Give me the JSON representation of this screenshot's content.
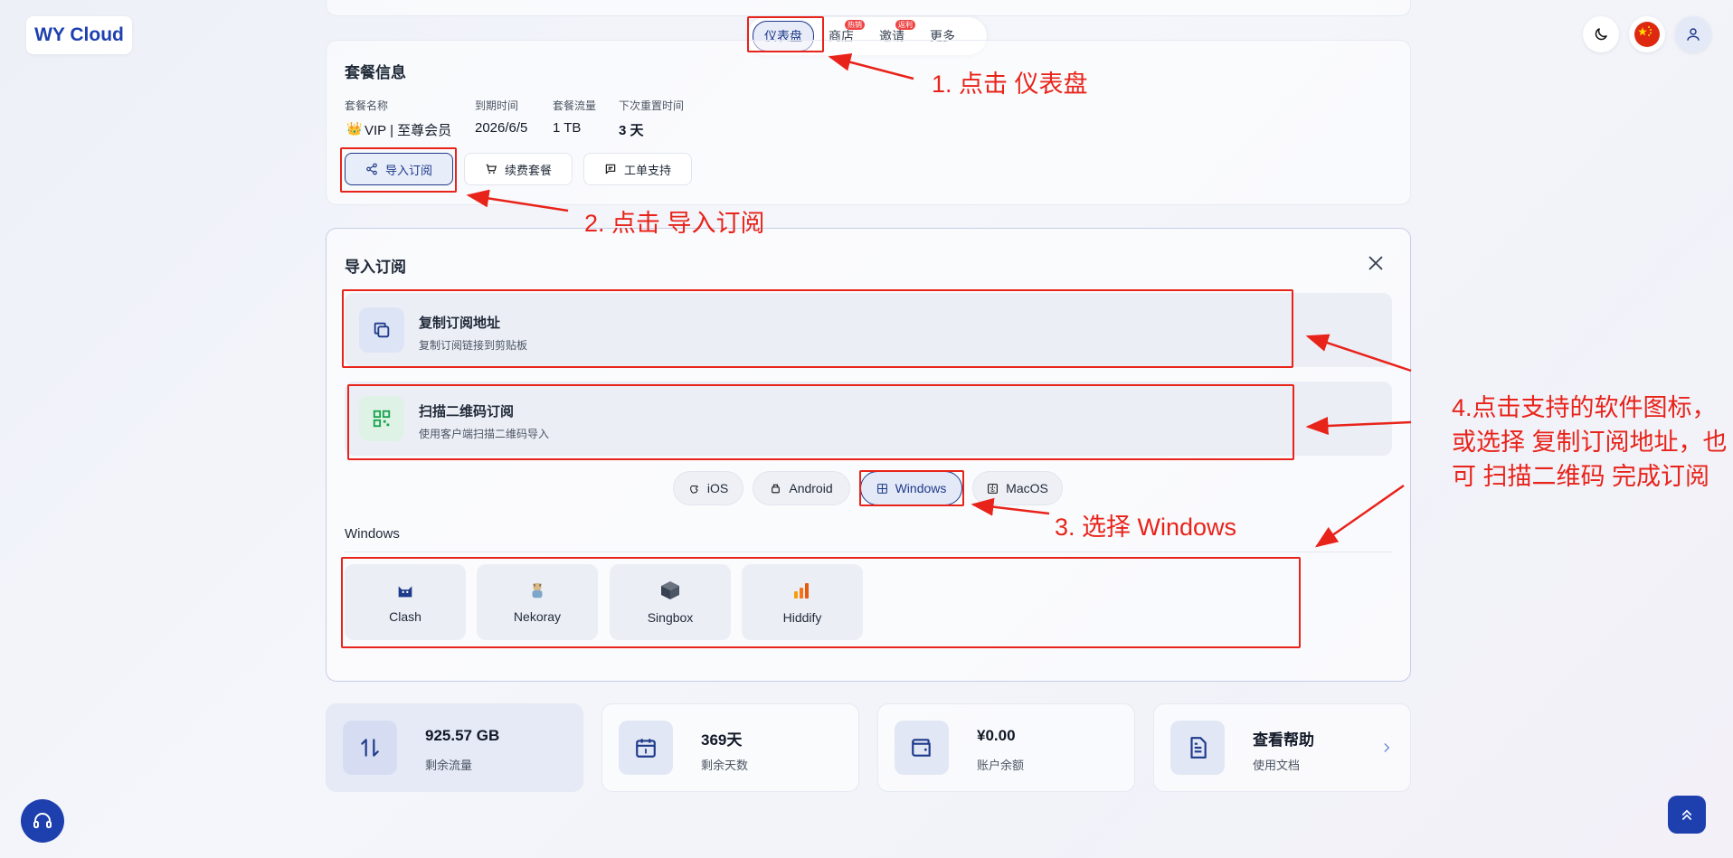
{
  "brand": {
    "name": "WY Cloud"
  },
  "topnav": {
    "items": [
      {
        "label": "仪表盘",
        "badge": ""
      },
      {
        "label": "商店",
        "badge": "热销"
      },
      {
        "label": "邀请",
        "badge": "返利"
      },
      {
        "label": "更多",
        "badge": ""
      }
    ]
  },
  "header_icons": [
    "moon-icon",
    "china-flag-icon",
    "user-icon"
  ],
  "plan": {
    "title": "套餐信息",
    "fields": [
      {
        "label": "套餐名称",
        "value": "VIP | 至尊会员"
      },
      {
        "label": "到期时间",
        "value": "2026/6/5"
      },
      {
        "label": "套餐流量",
        "value": "1 TB"
      },
      {
        "label": "下次重置时间",
        "value": "3 天"
      }
    ],
    "buttons": {
      "import": "导入订阅",
      "renew": "续费套餐",
      "ticket": "工单支持"
    }
  },
  "import_panel": {
    "title": "导入订阅",
    "options": [
      {
        "title": "复制订阅地址",
        "subtitle": "复制订阅链接到剪贴板",
        "icon": "copy-icon"
      },
      {
        "title": "扫描二维码订阅",
        "subtitle": "使用客户端扫描二维码导入",
        "icon": "qrcode-icon"
      }
    ],
    "os_tabs": [
      "iOS",
      "Android",
      "Windows",
      "MacOS"
    ],
    "active_os": "Windows",
    "section_label": "Windows",
    "clients": [
      "Clash",
      "Nekoray",
      "Singbox",
      "Hiddify"
    ]
  },
  "stats": [
    {
      "value": "925.57 GB",
      "label": "剩余流量",
      "icon": "transfer-icon"
    },
    {
      "value": "369天",
      "label": "剩余天数",
      "icon": "calendar-icon"
    },
    {
      "value": "¥0.00",
      "label": "账户余额",
      "icon": "wallet-icon"
    },
    {
      "value": "查看帮助",
      "label": "使用文档",
      "icon": "document-icon"
    }
  ],
  "annotations": {
    "step1": "1. 点击 仪表盘",
    "step2": "2. 点击 导入订阅",
    "step3": "3. 选择 Windows",
    "step4": "4.点击支持的软件图标，或选择 复制订阅地址，也可 扫描二维码 完成订阅"
  },
  "colors": {
    "accent": "#1e3a8a",
    "annotation": "#e8231a",
    "badge": "#ef4444"
  }
}
